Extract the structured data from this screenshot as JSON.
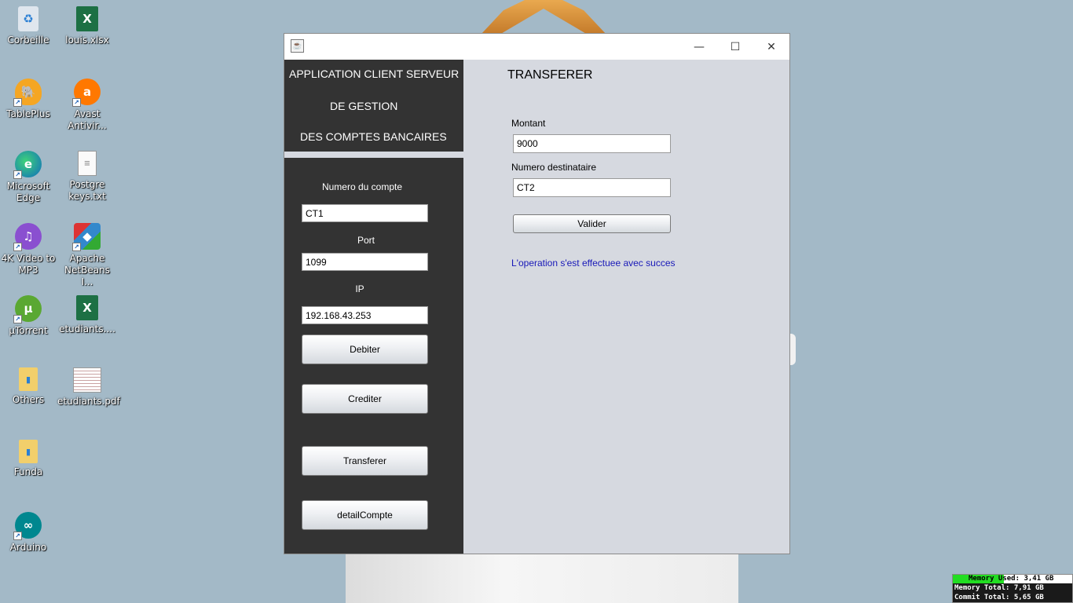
{
  "desktop": {
    "icons": [
      {
        "label": "Corbeille"
      },
      {
        "label": "louis.xlsx"
      },
      {
        "label": "TablePlus"
      },
      {
        "label": "Avast Antivir..."
      },
      {
        "label": "Microsoft Edge"
      },
      {
        "label": "Postgre keys.txt"
      },
      {
        "label": "4K Video to MP3"
      },
      {
        "label": "Apache NetBeans I..."
      },
      {
        "label": "µTorrent"
      },
      {
        "label": "etudiants...."
      },
      {
        "label": "Others"
      },
      {
        "label": "etudiants.pdf"
      },
      {
        "label": "Funda"
      },
      {
        "label": "Arduino"
      }
    ]
  },
  "window": {
    "controls": {
      "minimize": "—",
      "maximize": "☐",
      "close": "✕"
    },
    "sidebar": {
      "title_line1": "APPLICATION CLIENT SERVEUR",
      "title_line2": "DE GESTION",
      "title_line3": "DES COMPTES BANCAIRES",
      "account_label": "Numero du compte",
      "account_value": "CT1",
      "port_label": "Port",
      "port_value": "1099",
      "ip_label": "IP",
      "ip_value": "192.168.43.253",
      "buttons": {
        "debit": "Debiter",
        "credit": "Crediter",
        "transfer": "Transferer",
        "detail": "detailCompte"
      }
    },
    "main": {
      "title": "TRANSFERER",
      "amount_label": "Montant",
      "amount_value": "9000",
      "recipient_label": "Numero destinataire",
      "recipient_value": "CT2",
      "validate_button": "Valider",
      "status_message": "L'operation s'est effectuee avec succes",
      "status_color": "#1818b8"
    }
  },
  "memory_widget": {
    "used": "Memory Used: 3,41 GB",
    "total": "Memory Total: 7,91 GB",
    "commit": "Commit Total: 5,65 GB",
    "used_fraction": 0.43
  }
}
